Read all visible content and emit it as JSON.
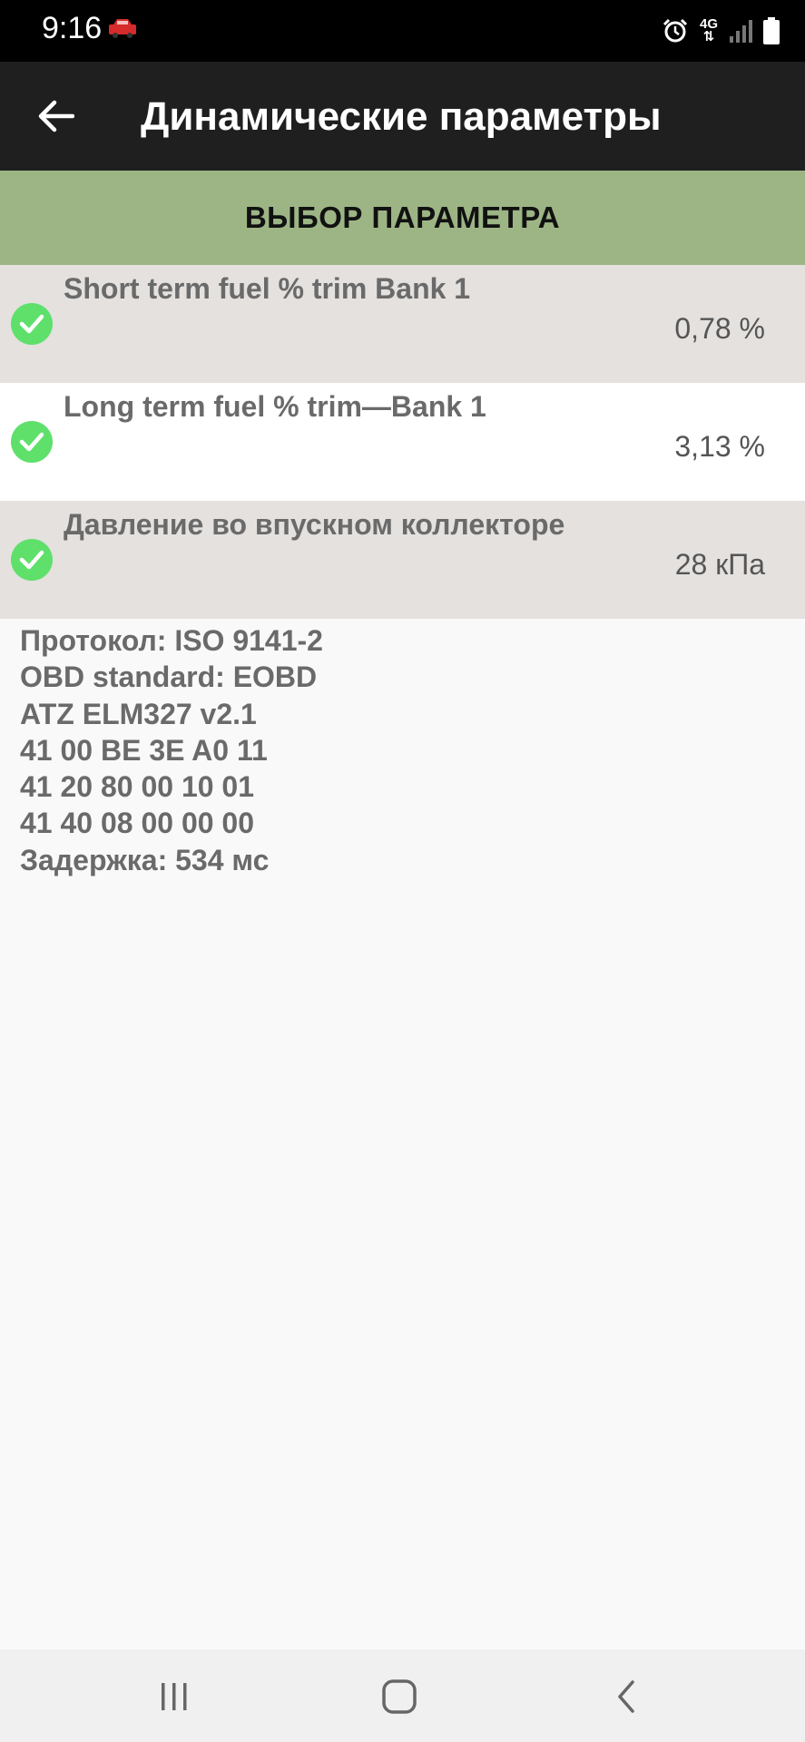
{
  "status_bar": {
    "time": "9:16",
    "network": "4G",
    "icons": [
      "car-icon",
      "alarm-icon",
      "signal-icon",
      "battery-icon"
    ]
  },
  "toolbar": {
    "title": "Динамические параметры",
    "back_icon": "arrow-left-icon"
  },
  "select_button": {
    "label": "ВЫБОР ПАРАМЕТРА"
  },
  "parameters": [
    {
      "name": "Short term fuel % trim Bank 1",
      "value": "0,78 %"
    },
    {
      "name": "Long term fuel % trim—Bank 1",
      "value": "3,13 %"
    },
    {
      "name": "Давление во впускном коллекторе",
      "value": "28 кПа"
    }
  ],
  "info_lines": [
    "Протокол: ISO 9141-2",
    "OBD standard: EOBD",
    "ATZ ELM327 v2.1",
    "41 00 BE 3E A0 11",
    "41 20 80 00 10 01",
    "41 40 08 00 00 00",
    "Задержка: 534 мс"
  ],
  "colors": {
    "status_bar": "#000000",
    "toolbar": "#1f1f1f",
    "accent_green": "#9db585",
    "check_green": "#5ee06b",
    "row_grey": "#e4e1df",
    "row_white": "#ffffff",
    "background": "#f9f9f9"
  }
}
